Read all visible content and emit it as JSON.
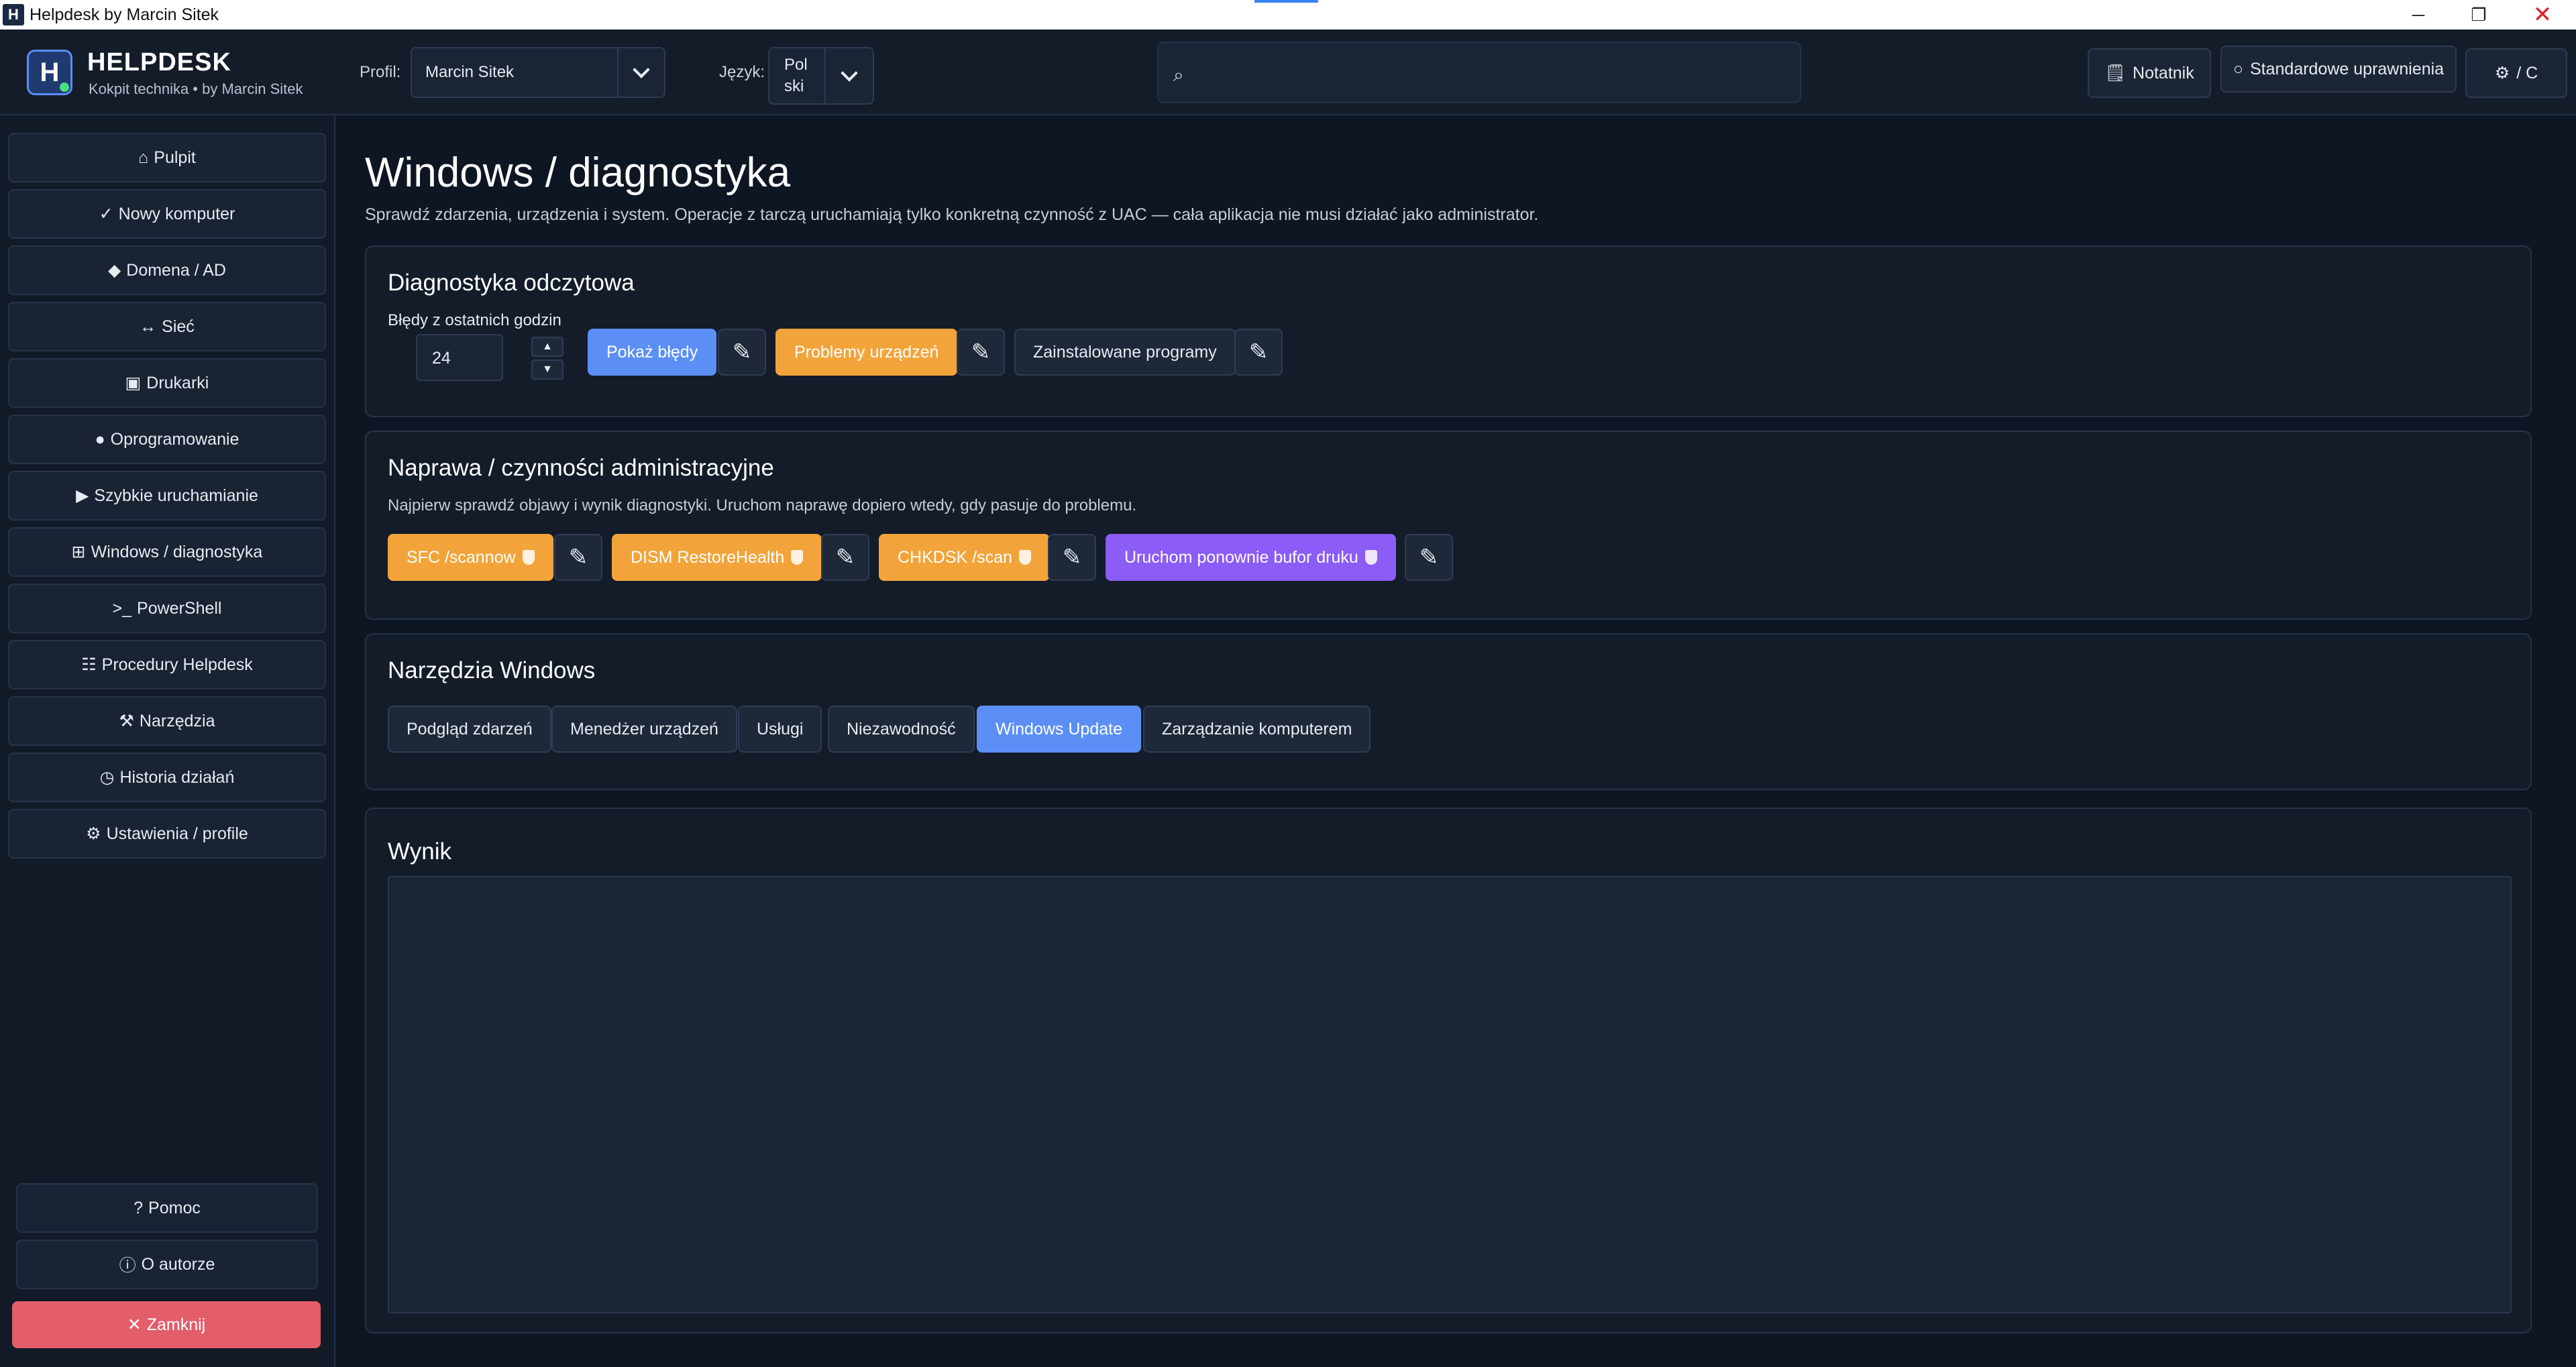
{
  "window": {
    "icon": "H",
    "title": "Helpdesk by Marcin Sitek",
    "minimize": "─",
    "maximize": "❐",
    "close": "✕"
  },
  "header": {
    "logo_letter": "H",
    "brand": "HELPDESK",
    "subtitle": "Kokpit technika • by Marcin Sitek",
    "profile_label": "Profil:",
    "profile_value": "Marcin Sitek",
    "language_label": "Język:",
    "language_value_1": "Pol",
    "language_value_2": "ski",
    "search_icon": "⌕",
    "search_placeholder": "",
    "notepad_icon": "🗒",
    "notepad_label": "Notatnik",
    "permissions_icon": "○",
    "permissions_label": "Standardowe uprawnienia",
    "settings_icon": "⚙",
    "settings_label": "/ C"
  },
  "sidebar": {
    "items": [
      {
        "icon": "⌂",
        "label": "Pulpit"
      },
      {
        "icon": "✓",
        "label": "Nowy komputer"
      },
      {
        "icon": "◆",
        "label": "Domena / AD"
      },
      {
        "icon": "↔",
        "label": "Sieć"
      },
      {
        "icon": "▣",
        "label": "Drukarki"
      },
      {
        "icon": "●",
        "label": "Oprogramowanie"
      },
      {
        "icon": "▶",
        "label": "Szybkie uruchamianie"
      },
      {
        "icon": "⊞",
        "label": "Windows / diagnostyka"
      },
      {
        "icon": ">_",
        "label": "PowerShell"
      },
      {
        "icon": "☷",
        "label": "Procedury Helpdesk"
      },
      {
        "icon": "⚒",
        "label": "Narzędzia"
      },
      {
        "icon": "◷",
        "label": "Historia działań"
      },
      {
        "icon": "⚙",
        "label": "Ustawienia / profile"
      }
    ],
    "bottom": [
      {
        "icon": "?",
        "label": "Pomoc"
      },
      {
        "icon": "ⓘ",
        "label": "O autorze"
      }
    ],
    "close": {
      "icon": "✕",
      "label": "Zamknij"
    }
  },
  "page": {
    "title": "Windows / diagnostyka",
    "description": "Sprawdź zdarzenia, urządzenia i system. Operacje z tarczą uruchamiają tylko konkretną czynność z UAC — cała aplikacja nie musi działać jako administrator."
  },
  "diagnostics": {
    "title": "Diagnostyka odczytowa",
    "hours_label": "Błędy z ostatnich godzin",
    "hours_value": "24",
    "up": "▲",
    "down": "▼",
    "edit_icon": "✎",
    "buttons": [
      "Pokaż błędy",
      "Problemy urządzeń",
      "Zainstalowane programy"
    ]
  },
  "repair": {
    "title": "Naprawa / czynności administracyjne",
    "subtitle": "Najpierw sprawdź objawy i wynik diagnostyki. Uruchom naprawę dopiero wtedy, gdy pasuje do problemu.",
    "buttons": [
      "SFC /scannow",
      "DISM RestoreHealth",
      "CHKDSK /scan",
      "Uruchom ponownie bufor druku"
    ]
  },
  "tools": {
    "title": "Narzędzia Windows",
    "buttons": [
      "Podgląd zdarzeń",
      "Menedżer urządzeń",
      "Usługi",
      "Niezawodność",
      "Windows Update",
      "Zarządzanie komputerem"
    ]
  },
  "result": {
    "title": "Wynik",
    "content": ""
  },
  "colors": {
    "accent_blue": "#5b8ff5",
    "admin_orange": "#f2a43a",
    "spooler_purple": "#8b5cf6",
    "close_red": "#e35d6a"
  }
}
